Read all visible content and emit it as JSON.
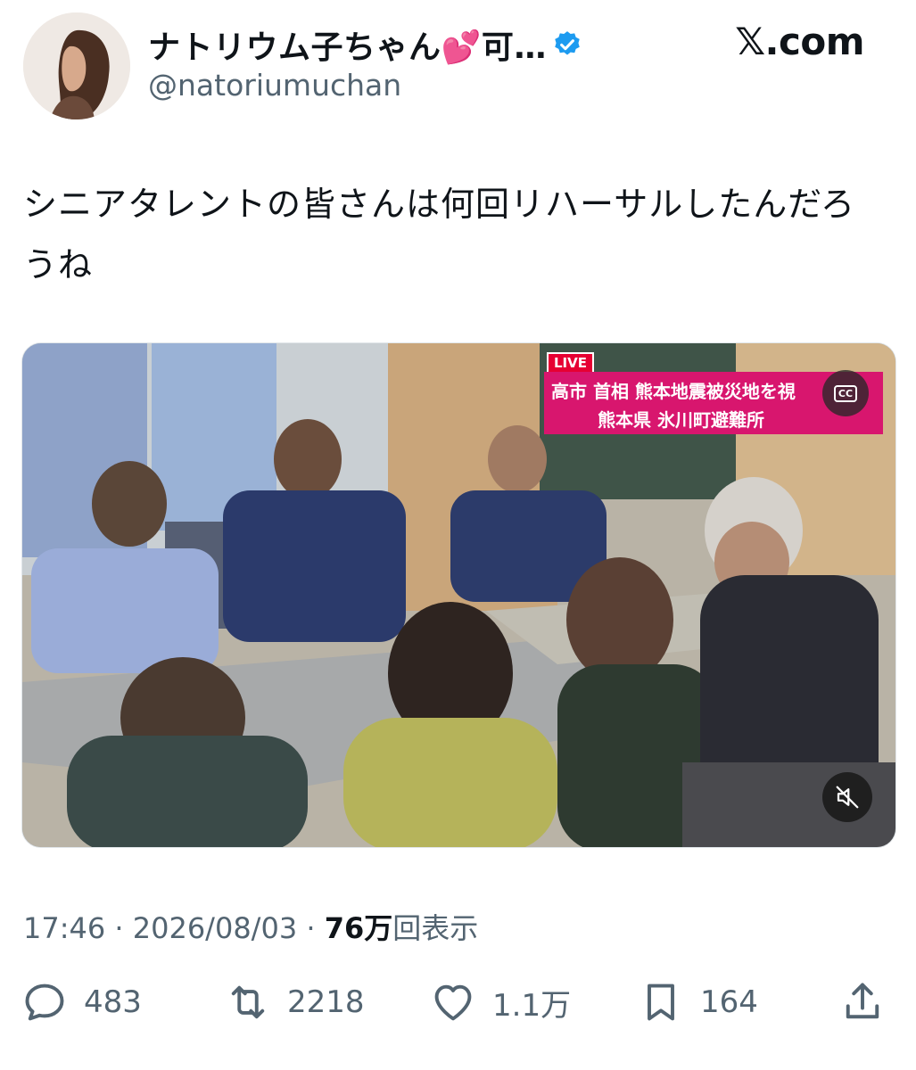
{
  "author": {
    "display_name": "ナトリウム子ちゃん💕可…",
    "handle": "@natoriumuchan",
    "verified": true
  },
  "site_logo": "𝕏.com",
  "tweet": {
    "text": "シニアタレントの皆さんは何回リハーサルしたんだろうね"
  },
  "video": {
    "live_label": "LIVE",
    "banner_line1": "高市 首相 熊本地震被災地を視",
    "banner_line2": "熊本県 氷川町避難所",
    "cc_label": "CC",
    "muted": true
  },
  "meta": {
    "time": "17:46",
    "separator": "·",
    "date": "2026/08/03",
    "views_count": "76万",
    "views_label": "回表示"
  },
  "actions": {
    "replies": "483",
    "reposts": "2218",
    "likes": "1.1万",
    "bookmarks": "164"
  },
  "colors": {
    "text": "#0f1419",
    "secondary": "#536471",
    "verified_blue": "#1d9bf0",
    "news_banner": "#d8166e"
  }
}
